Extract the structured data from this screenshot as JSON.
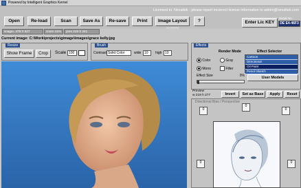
{
  "window": {
    "title": "Powered by Intelligent Graphics Kernel"
  },
  "license_message": "Licensed to: Nevaltek - please report incorrect license information to admin@nevaltek.com",
  "toolbar": {
    "open": "Open",
    "reload": "Re-load",
    "scan": "Scan",
    "save_as": "Save As",
    "resave": "Re-save",
    "print": "Print",
    "image_layout": "Image Layout",
    "image_layout_sub": "SCREEN",
    "help": "?",
    "enter_lic": "Enter Lic KEY"
  },
  "serial": {
    "label": "Serial No.",
    "value": "DE E4-46F3"
  },
  "status": {
    "image_size": "image= 478 X 527",
    "zoom": "zoom 41%",
    "preview_size": "prev 219 X 241"
  },
  "current_image": "Current image: C:\\Work\\projects\\gimage\\images\\grace kelly.jpg",
  "resize": {
    "label": "Resize",
    "show_frame": "Show Frame",
    "crop": "Crop",
    "scale": "Scale",
    "scale_value": "100"
  },
  "brush": {
    "label": "Brush",
    "contrast_label": "Contrast",
    "contrast_value": "Solid Color",
    "wide_label": "wide",
    "wide_value": "10",
    "high_label": "high",
    "high_value": "10"
  },
  "effects": {
    "label": "Effects",
    "render_mode_label": "Render Mode",
    "modes": [
      "Color",
      "Gray",
      "Mono",
      "Filter"
    ],
    "selector_label": "Effect Selector",
    "selector_items": [
      "Cartoon",
      "Directional",
      "Oil Paint",
      "Pencil Sketch"
    ],
    "size_label": "Effect Size",
    "size_value": "0%",
    "user_models": "User Models"
  },
  "preview": {
    "label": "Preview",
    "size": "w 219 h 277",
    "invert": "Invert",
    "set_base": "Set as Base",
    "apply": "Apply",
    "reset": "Reset",
    "effect_name": "Directional Bias / Perspective",
    "spinner_value": "0"
  }
}
